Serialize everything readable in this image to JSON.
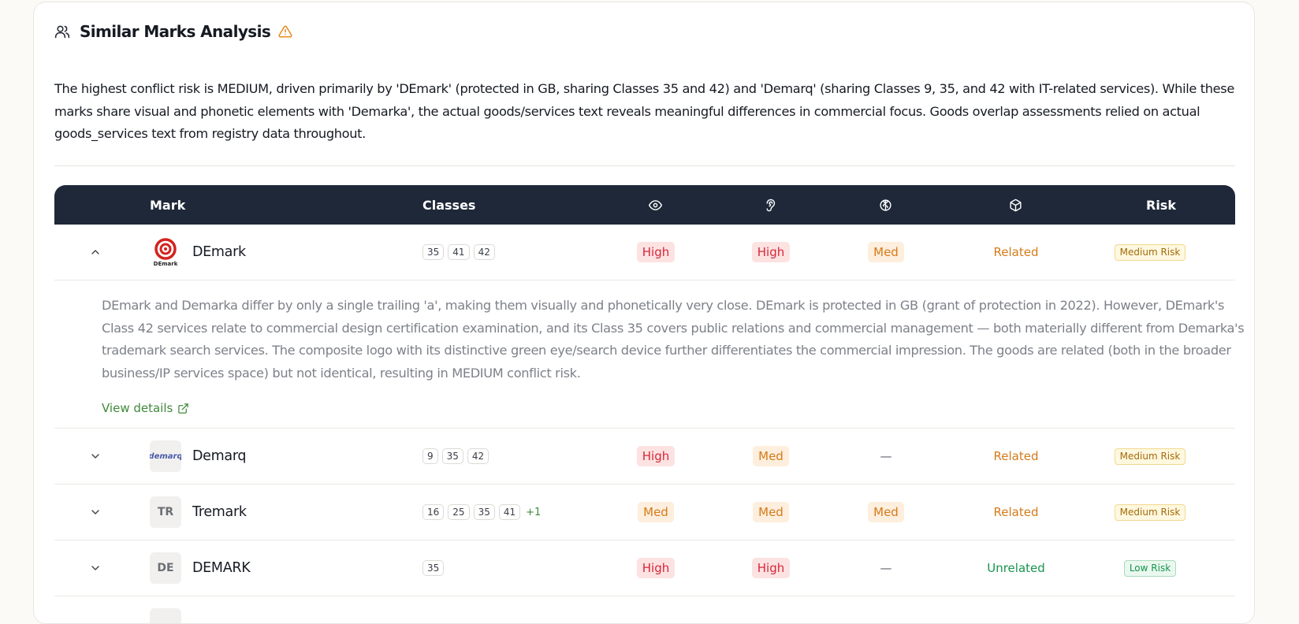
{
  "header": {
    "title": "Similar Marks Analysis"
  },
  "summary": "The highest conflict risk is MEDIUM, driven primarily by 'DEmark' (protected in GB, sharing Classes 35 and 42) and 'Demarq' (sharing Classes 9, 35, and 42 with IT-related services). While these marks share visual and phonetic elements with 'Demarka', the actual goods/services text reveals meaningful differences in commercial focus. Goods overlap assessments relied on actual goods_services text from registry data throughout.",
  "table": {
    "columns": {
      "mark": "Mark",
      "classes": "Classes",
      "visual_icon": "eye-icon",
      "phonetic_icon": "ear-icon",
      "conceptual_icon": "brain-icon",
      "goods_icon": "box-icon",
      "risk": "Risk"
    },
    "rows": [
      {
        "name": "DEmark",
        "logo_text": "DEmark",
        "classes": [
          "35",
          "41",
          "42"
        ],
        "visual": "High",
        "phonetic": "High",
        "conceptual": "Med",
        "goods": "Related",
        "risk": "Medium Risk",
        "expanded": true,
        "reason": "DEmark and Demarka differ by only a single trailing 'a', making them visually and phonetically very close. DEmark is protected in GB (grant of protection in 2022). However, DEmark's Class 42 services relate to commercial design certification examination, and its Class 35 covers public relations and commercial management — both materially different from Demarka's trademark search services. The composite logo with its distinctive green eye/search device further differentiates the commercial impression. The goods are related (both in the broader business/IP services space) but not identical, resulting in MEDIUM conflict risk.",
        "view_details": "View details"
      },
      {
        "name": "Demarq",
        "logo_text": "demarq",
        "classes": [
          "9",
          "35",
          "42"
        ],
        "visual": "High",
        "phonetic": "Med",
        "conceptual": "—",
        "goods": "Related",
        "risk": "Medium Risk"
      },
      {
        "name": "Tremark",
        "logo_text": "TR",
        "classes": [
          "16",
          "25",
          "35",
          "41"
        ],
        "more": "+1",
        "visual": "Med",
        "phonetic": "Med",
        "conceptual": "Med",
        "goods": "Related",
        "risk": "Medium Risk"
      },
      {
        "name": "DEMARK",
        "logo_text": "DE",
        "classes": [
          "35"
        ],
        "visual": "High",
        "phonetic": "High",
        "conceptual": "—",
        "goods": "Unrelated",
        "risk": "Low Risk"
      }
    ]
  },
  "colors": {
    "header_bg": "#1e2838",
    "high": "#d5283a",
    "med": "#d47b1a",
    "unrelated": "#17944e",
    "link": "#3f8a3a"
  }
}
